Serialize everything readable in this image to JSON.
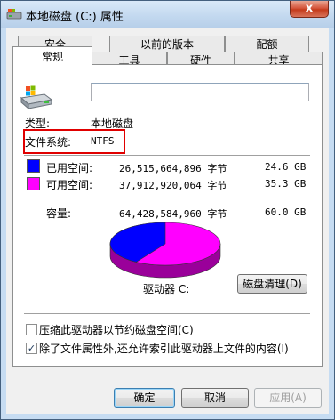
{
  "window": {
    "title": "本地磁盘 (C:) 属性",
    "close_glyph": "x"
  },
  "tabs": {
    "row1": [
      "安全",
      "以前的版本",
      "配额"
    ],
    "row2": [
      "常规",
      "工具",
      "硬件",
      "共享"
    ],
    "active": "常规"
  },
  "general": {
    "drive_name_value": "",
    "type_label": "类型:",
    "type_value": "本地磁盘",
    "fs_label": "文件系统:",
    "fs_value": "NTFS",
    "used": {
      "label": "已用空间:",
      "bytes": "26,515,664,896 字节",
      "size": "24.6 GB",
      "color": "#0000ff"
    },
    "free": {
      "label": "可用空间:",
      "bytes": "37,912,920,064 字节",
      "size": "35.3 GB",
      "color": "#ff00ff"
    },
    "capacity": {
      "label": "容量:",
      "bytes": "64,428,584,960 字节",
      "size": "60.0 GB"
    },
    "drive_caption": "驱动器 C:",
    "cleanup_button": "磁盘清理(D)",
    "compress_label": "压缩此驱动器以节约磁盘空间(C)",
    "compress_checked": false,
    "index_label": "除了文件属性外,还允许索引此驱动器上文件的内容(I)",
    "index_checked": true
  },
  "pie_chart": {
    "used_fraction": 0.4116,
    "free_fraction": 0.5884
  },
  "buttons": {
    "ok": "确定",
    "cancel": "取消",
    "apply": "应用(A)"
  }
}
